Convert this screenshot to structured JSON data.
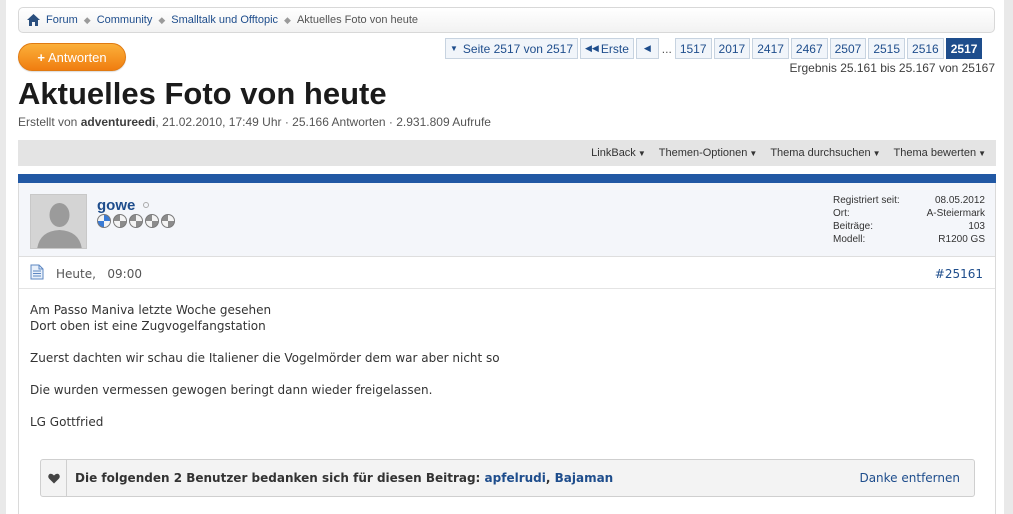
{
  "breadcrumb": {
    "items": [
      "Forum",
      "Community",
      "Smalltalk und Offtopic"
    ],
    "current": "Aktuelles Foto von heute"
  },
  "reply_button": {
    "plus": "+",
    "label": "Antworten"
  },
  "pagination": {
    "page_of": "Seite 2517 von 2517",
    "first": "Erste",
    "prev_icon": "chevron-left-icon",
    "dots": "...",
    "pages": [
      "1517",
      "2017",
      "2417",
      "2467",
      "2507",
      "2515",
      "2516"
    ],
    "current_page": "2517"
  },
  "results": "Ergebnis 25.161 bis 25.167 von 25167",
  "thread": {
    "title": "Aktuelles Foto von heute",
    "created_prefix": "Erstellt von ",
    "author": "adventureedi",
    "created_suffix": ", 21.02.2010, 17:49 Uhr · 25.166 Antworten · 2.931.809 Aufrufe"
  },
  "tools": [
    "LinkBack",
    "Themen-Optionen",
    "Thema durchsuchen",
    "Thema bewerten"
  ],
  "post": {
    "username": "gowe",
    "stats": [
      {
        "label": "Registriert seit:",
        "value": "08.05.2012"
      },
      {
        "label": "Ort:",
        "value": "A-Steiermark"
      },
      {
        "label": "Beiträge:",
        "value": "103"
      },
      {
        "label": "Modell:",
        "value": "R1200 GS"
      }
    ],
    "date": "Heute,",
    "time": "09:00",
    "number": "#25161",
    "body": {
      "l1": "Am Passo Maniva letzte Woche gesehen",
      "l2": "Dort oben ist eine Zugvogelfangstation",
      "l3": "Zuerst dachten wir schau die Italiener die Vogelmörder dem war aber nicht so",
      "l4": "Die wurden vermessen gewogen beringt dann wieder freigelassen.",
      "l5": "LG Gottfried"
    },
    "thanks": {
      "text": "Die folgenden 2 Benutzer bedanken sich für diesen Beitrag:",
      "users": [
        "apfelrudi",
        "Bajaman"
      ],
      "separator": ",",
      "remove": "Danke entfernen"
    }
  },
  "colors": {
    "link": "#1e4d8c",
    "accent_orange": "#f39a24",
    "post_bar": "#2158a4",
    "active_page": "#1e4d8c"
  }
}
